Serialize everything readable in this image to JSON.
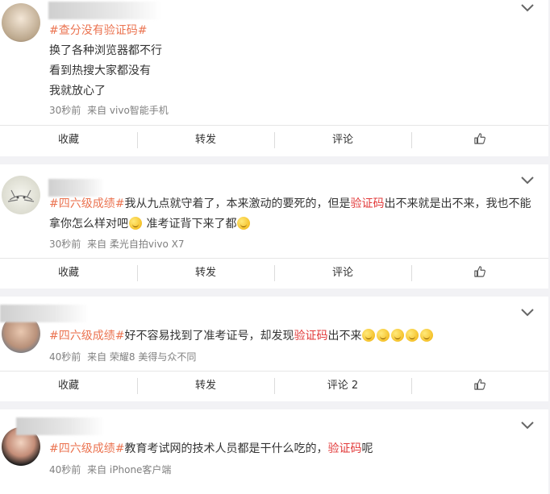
{
  "posts": [
    {
      "tag": "#查分没有验证码#",
      "lines": [
        "换了各种浏览器都不行",
        "看到热搜大家都没有",
        "我就放心了"
      ],
      "time": "30秒前",
      "source": "来自 vivo智能手机",
      "actions": {
        "favorite": "收藏",
        "repost": "转发",
        "comment": "评论"
      }
    },
    {
      "tag": "#四六级成绩#",
      "text_a": "我从九点就守着了，本来激动的要死的，但是",
      "highlight": "验证码",
      "text_b": "出不来就是出不来，我也不能拿你怎么样对吧",
      "text_c": " 准考证背下来了都",
      "time": "30秒前",
      "source": "来自 柔光自拍vivo X7",
      "actions": {
        "favorite": "收藏",
        "repost": "转发",
        "comment": "评论"
      }
    },
    {
      "tag": "#四六级成绩#",
      "text_a": "好不容易找到了准考证号，却发现",
      "highlight": "验证码",
      "text_b": "出不来",
      "time": "40秒前",
      "source": "来自 荣耀8 美得与众不同",
      "actions": {
        "favorite": "收藏",
        "repost": "转发",
        "comment": "评论 2"
      }
    },
    {
      "tag": "#四六级成绩#",
      "text_a": "教育考试网的技术人员都是干什么吃的，",
      "highlight": "验证码",
      "text_b": "呢",
      "time": "40秒前",
      "source": "来自 iPhone客户端"
    }
  ],
  "icons": {
    "expand": "chevron-down-icon",
    "like": "thumbs-up-icon",
    "emoji": "smiley-emoji-icon"
  },
  "colors": {
    "tag": "#eb7350",
    "highlight": "#e23a3a",
    "meta": "#808080",
    "background": "#f2f2f5"
  }
}
